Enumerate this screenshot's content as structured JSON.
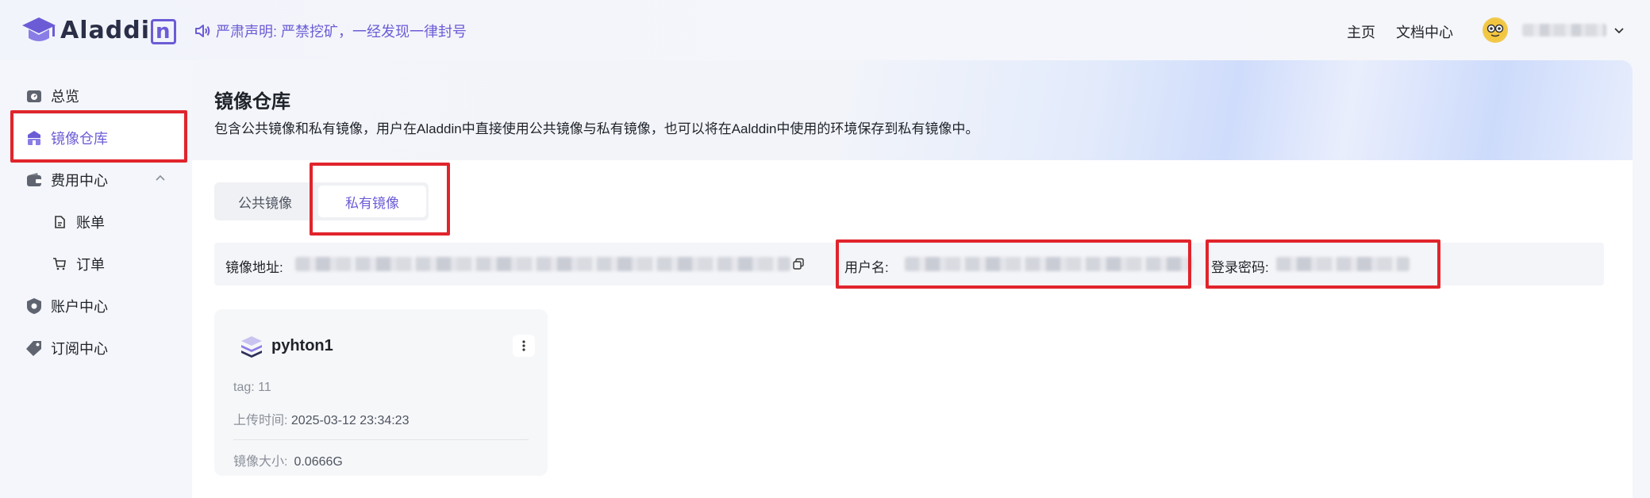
{
  "brand": {
    "name": "Aladdi",
    "name_box_letter": "n"
  },
  "notice": {
    "text": "严肃声明: 严禁挖矿，一经发现一律封号"
  },
  "header": {
    "home": "主页",
    "docs": "文档中心"
  },
  "sidebar": {
    "items": [
      {
        "label": "总览",
        "icon": "dashboard-icon"
      },
      {
        "label": "镜像仓库",
        "icon": "image-repo-icon",
        "active": true
      },
      {
        "label": "费用中心",
        "icon": "wallet-icon",
        "expanded": true
      },
      {
        "label": "账单",
        "icon": "bill-icon"
      },
      {
        "label": "订单",
        "icon": "cart-icon"
      },
      {
        "label": "账户中心",
        "icon": "shield-icon"
      },
      {
        "label": "订阅中心",
        "icon": "tag-icon"
      }
    ]
  },
  "page": {
    "title": "镜像仓库",
    "description": "包含公共镜像和私有镜像，用户在Aladdin中直接使用公共镜像与私有镜像，也可以将在Aalddin中使用的环境保存到私有镜像中。"
  },
  "tabs": [
    {
      "label": "公共镜像"
    },
    {
      "label": "私有镜像",
      "selected": true
    }
  ],
  "registry": {
    "address_label": "镜像地址:",
    "username_label": "用户名:",
    "password_label": "登录密码:"
  },
  "images": [
    {
      "name": "pyhton1",
      "tag_label": "tag:",
      "tag": "11",
      "time_label": "上传时间:",
      "time": "2025-03-12 23:34:23",
      "size_label": "镜像大小:",
      "size": "0.0666G"
    }
  ],
  "colors": {
    "accent": "#6b5cd6",
    "highlight": "#e1242c"
  }
}
